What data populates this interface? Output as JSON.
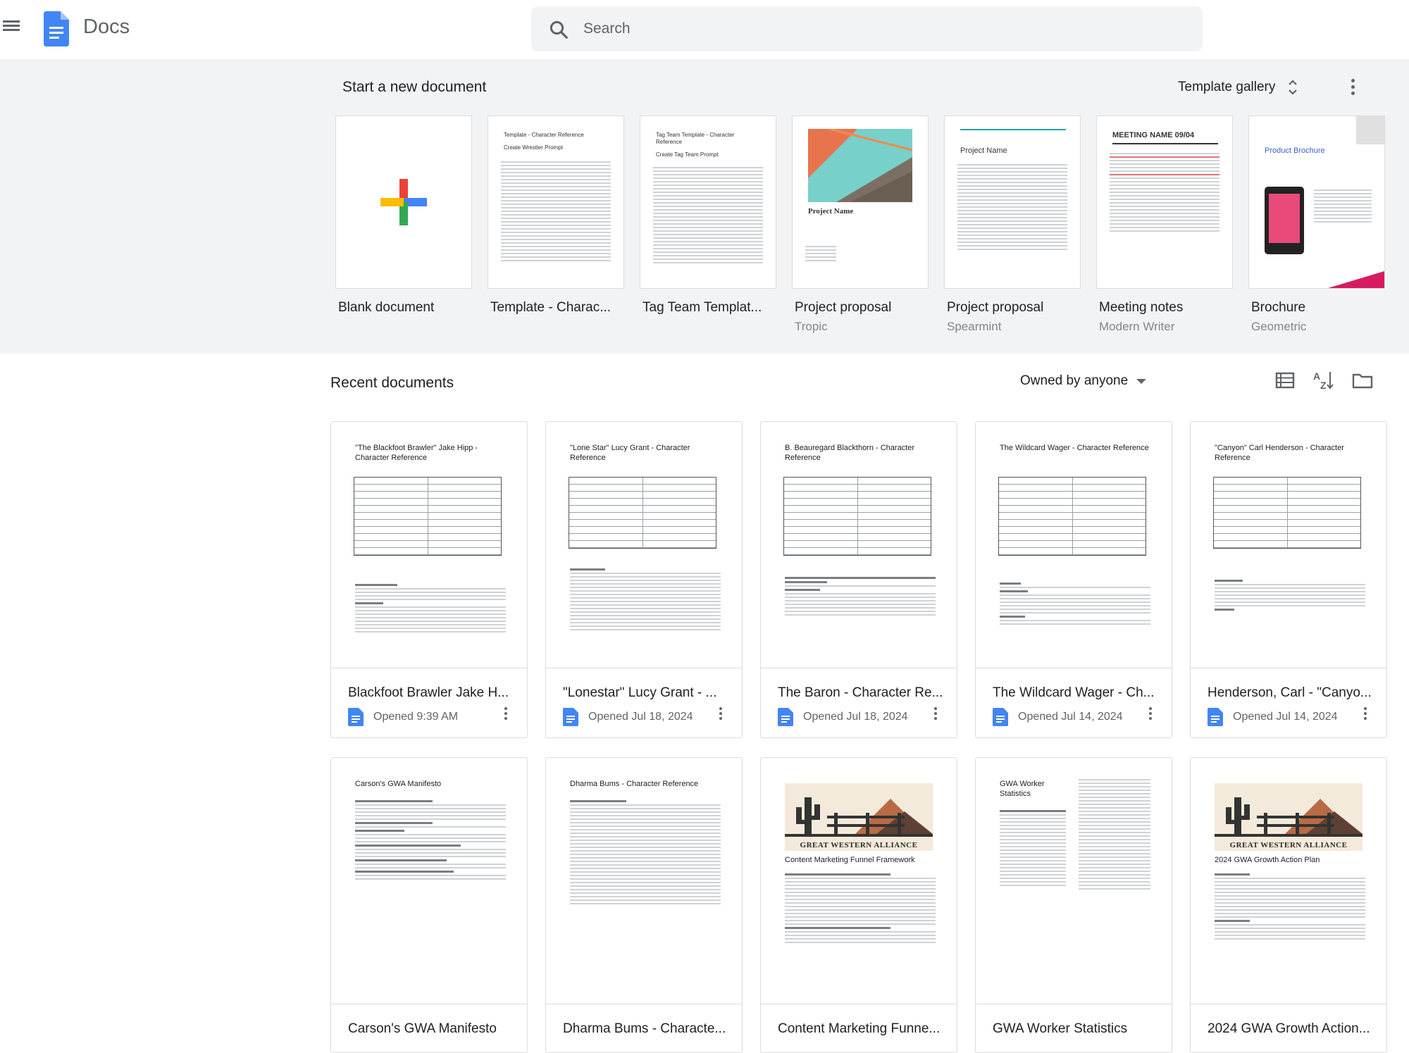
{
  "header": {
    "app_title": "Docs",
    "search_placeholder": "Search"
  },
  "templates": {
    "title": "Start a new document",
    "gallery_label": "Template gallery",
    "items": [
      {
        "name": "Blank document",
        "sub": ""
      },
      {
        "name": "Template - Charac...",
        "sub": "",
        "thumb_title": "Template - Character Reference",
        "thumb_subtitle": "Create Wrestler Prompt"
      },
      {
        "name": "Tag Team Templat...",
        "sub": "",
        "thumb_title": "Tag Team Template - Character Reference",
        "thumb_subtitle": "Create Tag Team Prompt"
      },
      {
        "name": "Project proposal",
        "sub": "Tropic",
        "thumb_title": "Project Name"
      },
      {
        "name": "Project proposal",
        "sub": "Spearmint",
        "thumb_title": "Project Name"
      },
      {
        "name": "Meeting notes",
        "sub": "Modern Writer",
        "thumb_title": "MEETING NAME 09/04"
      },
      {
        "name": "Brochure",
        "sub": "Geometric",
        "thumb_title": "Product Brochure"
      }
    ]
  },
  "recent": {
    "title": "Recent documents",
    "owner_filter": "Owned by anyone",
    "docs": [
      {
        "title": "Blackfoot Brawler Jake H...",
        "meta": "Opened 9:39 AM",
        "thumb_title": "\"The Blackfoot Brawler\" Jake Hipp - Character Reference"
      },
      {
        "title": "\"Lonestar\" Lucy Grant - ...",
        "meta": "Opened Jul 18, 2024",
        "thumb_title": "\"Lone Star\" Lucy Grant - Character Reference"
      },
      {
        "title": "The Baron - Character Re...",
        "meta": "Opened Jul 18, 2024",
        "thumb_title": "B. Beauregard Blackthorn - Character Reference"
      },
      {
        "title": "The Wildcard Wager - Ch...",
        "meta": "Opened Jul 14, 2024",
        "thumb_title": "The Wildcard Wager - Character Reference"
      },
      {
        "title": "Henderson, Carl - \"Canyo...",
        "meta": "Opened Jul 14, 2024",
        "thumb_title": "\"Canyon\" Carl Henderson - Character Reference"
      },
      {
        "title": "Carson's GWA Manifesto",
        "meta": "",
        "thumb_title": "Carson's GWA Manifesto"
      },
      {
        "title": "Dharma Bums - Characte...",
        "meta": "",
        "thumb_title": "Dharma Bums - Character Reference"
      },
      {
        "title": "Content Marketing Funne...",
        "meta": "",
        "thumb_title": "Content Marketing Funnel Framework",
        "banner": "GREAT WESTERN ALLIANCE"
      },
      {
        "title": "GWA Worker Statistics",
        "meta": "",
        "thumb_title": "GWA Worker Statistics"
      },
      {
        "title": "2024 GWA Growth Action...",
        "meta": "",
        "thumb_title": "2024 GWA Growth Action Plan",
        "banner": "GREAT WESTERN ALLIANCE"
      }
    ]
  },
  "colors": {
    "docs_blue": "#4285f4",
    "section_bg": "#f1f3f4",
    "text_secondary": "#5f6368"
  }
}
